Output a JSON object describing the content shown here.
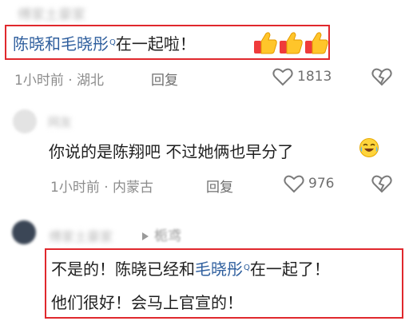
{
  "comment1": {
    "username": "傅家土豪家",
    "text_link": "陈晓和毛晓彤",
    "text_rest": "在一起啦！",
    "time": "1小时前",
    "location": "湖北",
    "reply_label": "回复",
    "likes": "1813"
  },
  "comment2": {
    "username": "网友",
    "text": "你说的是陈翔吧 不过她俩也早分了",
    "time": "1小时前",
    "location": "内蒙古",
    "reply_label": "回复",
    "likes": "976"
  },
  "comment3": {
    "username": "傅家土豪家",
    "reply_to": "栀鸢",
    "line1_a": "不是的！陈晓已经和",
    "line1_link": "毛晓彤",
    "line1_b": "在一起了！",
    "line2": "他们很好！会马上官宣的！"
  },
  "icons": [
    "search-icon",
    "thumbs-up-icon",
    "heart-icon",
    "dislike-icon",
    "crying-laugh-icon",
    "play-arrow-icon"
  ],
  "colors": {
    "highlight_border": "#e0282d",
    "link": "#2f5f9e",
    "meta": "#8c8c8c"
  }
}
